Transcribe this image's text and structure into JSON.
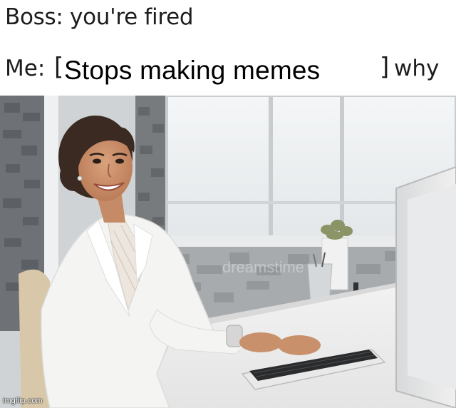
{
  "caption": {
    "line1": "Boss: you're fired",
    "line2_prefix": "Me:",
    "open_bracket": "[",
    "overlay_text": "Stops making memes",
    "close_bracket": "]",
    "line2_suffix": "why"
  },
  "watermark": "imgflip.com",
  "stock_watermark": "dreamstime"
}
